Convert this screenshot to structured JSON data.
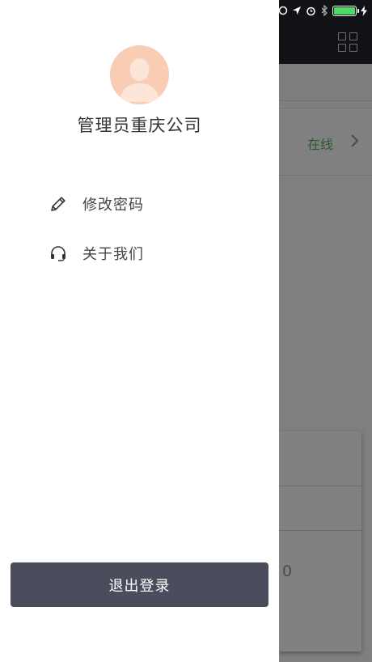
{
  "background": {
    "status_text": "在线",
    "card_value": "0"
  },
  "drawer": {
    "username": "管理员重庆公司",
    "menu": [
      {
        "label": "修改密码",
        "icon": "pencil-icon"
      },
      {
        "label": "关于我们",
        "icon": "headset-icon"
      }
    ],
    "logout_label": "退出登录"
  },
  "colors": {
    "logout_button": "#4b4c5c",
    "avatar_bg": "#f8cdb4",
    "overlay": "#7f7f7f",
    "online_text": "#2a5a35"
  }
}
